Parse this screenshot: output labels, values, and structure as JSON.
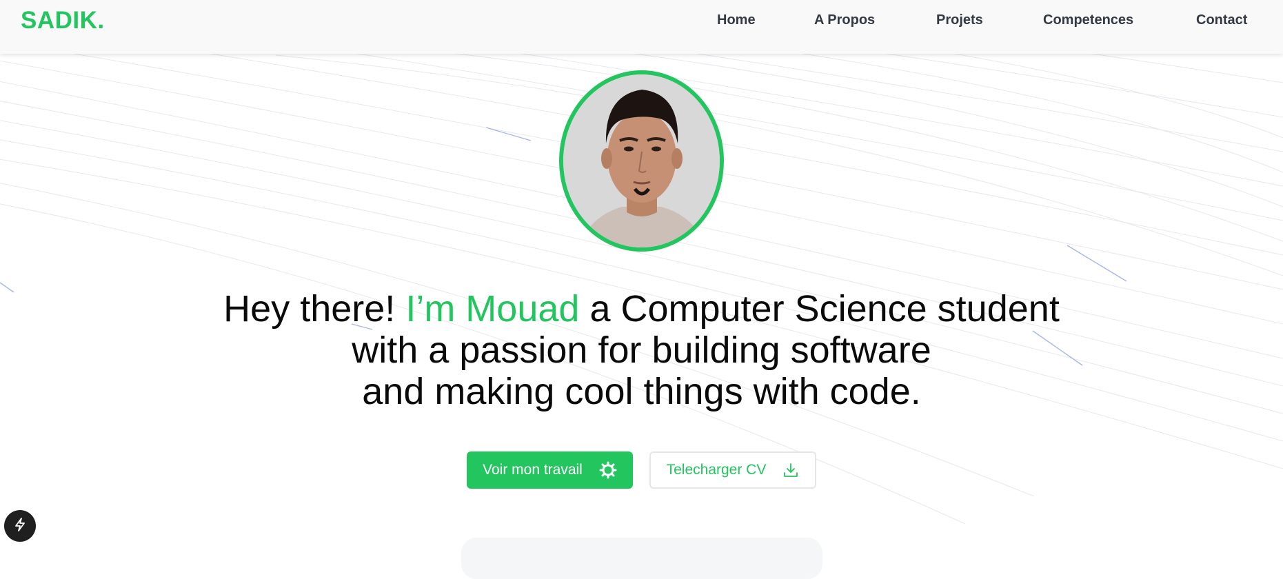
{
  "brand": {
    "name": "SADIK."
  },
  "nav": {
    "items": [
      "Home",
      "A Propos",
      "Projets",
      "Competences",
      "Contact"
    ]
  },
  "hero": {
    "line1_prefix": "Hey there!",
    "line1_accent": "I’m Mouad",
    "line1_suffix": "a Computer Science student",
    "line2": "with a passion for building software",
    "line3": "and making cool things with code."
  },
  "buttons": {
    "primary_label": "Voir mon travail",
    "secondary_label": "Telecharger CV",
    "primary_icon": "gear-icon",
    "secondary_icon": "download-icon"
  },
  "floating": {
    "icon": "bolt-icon"
  },
  "colors": {
    "accent": "#22c55e",
    "nav_text": "#333a44",
    "text": "#0a0a0a"
  }
}
